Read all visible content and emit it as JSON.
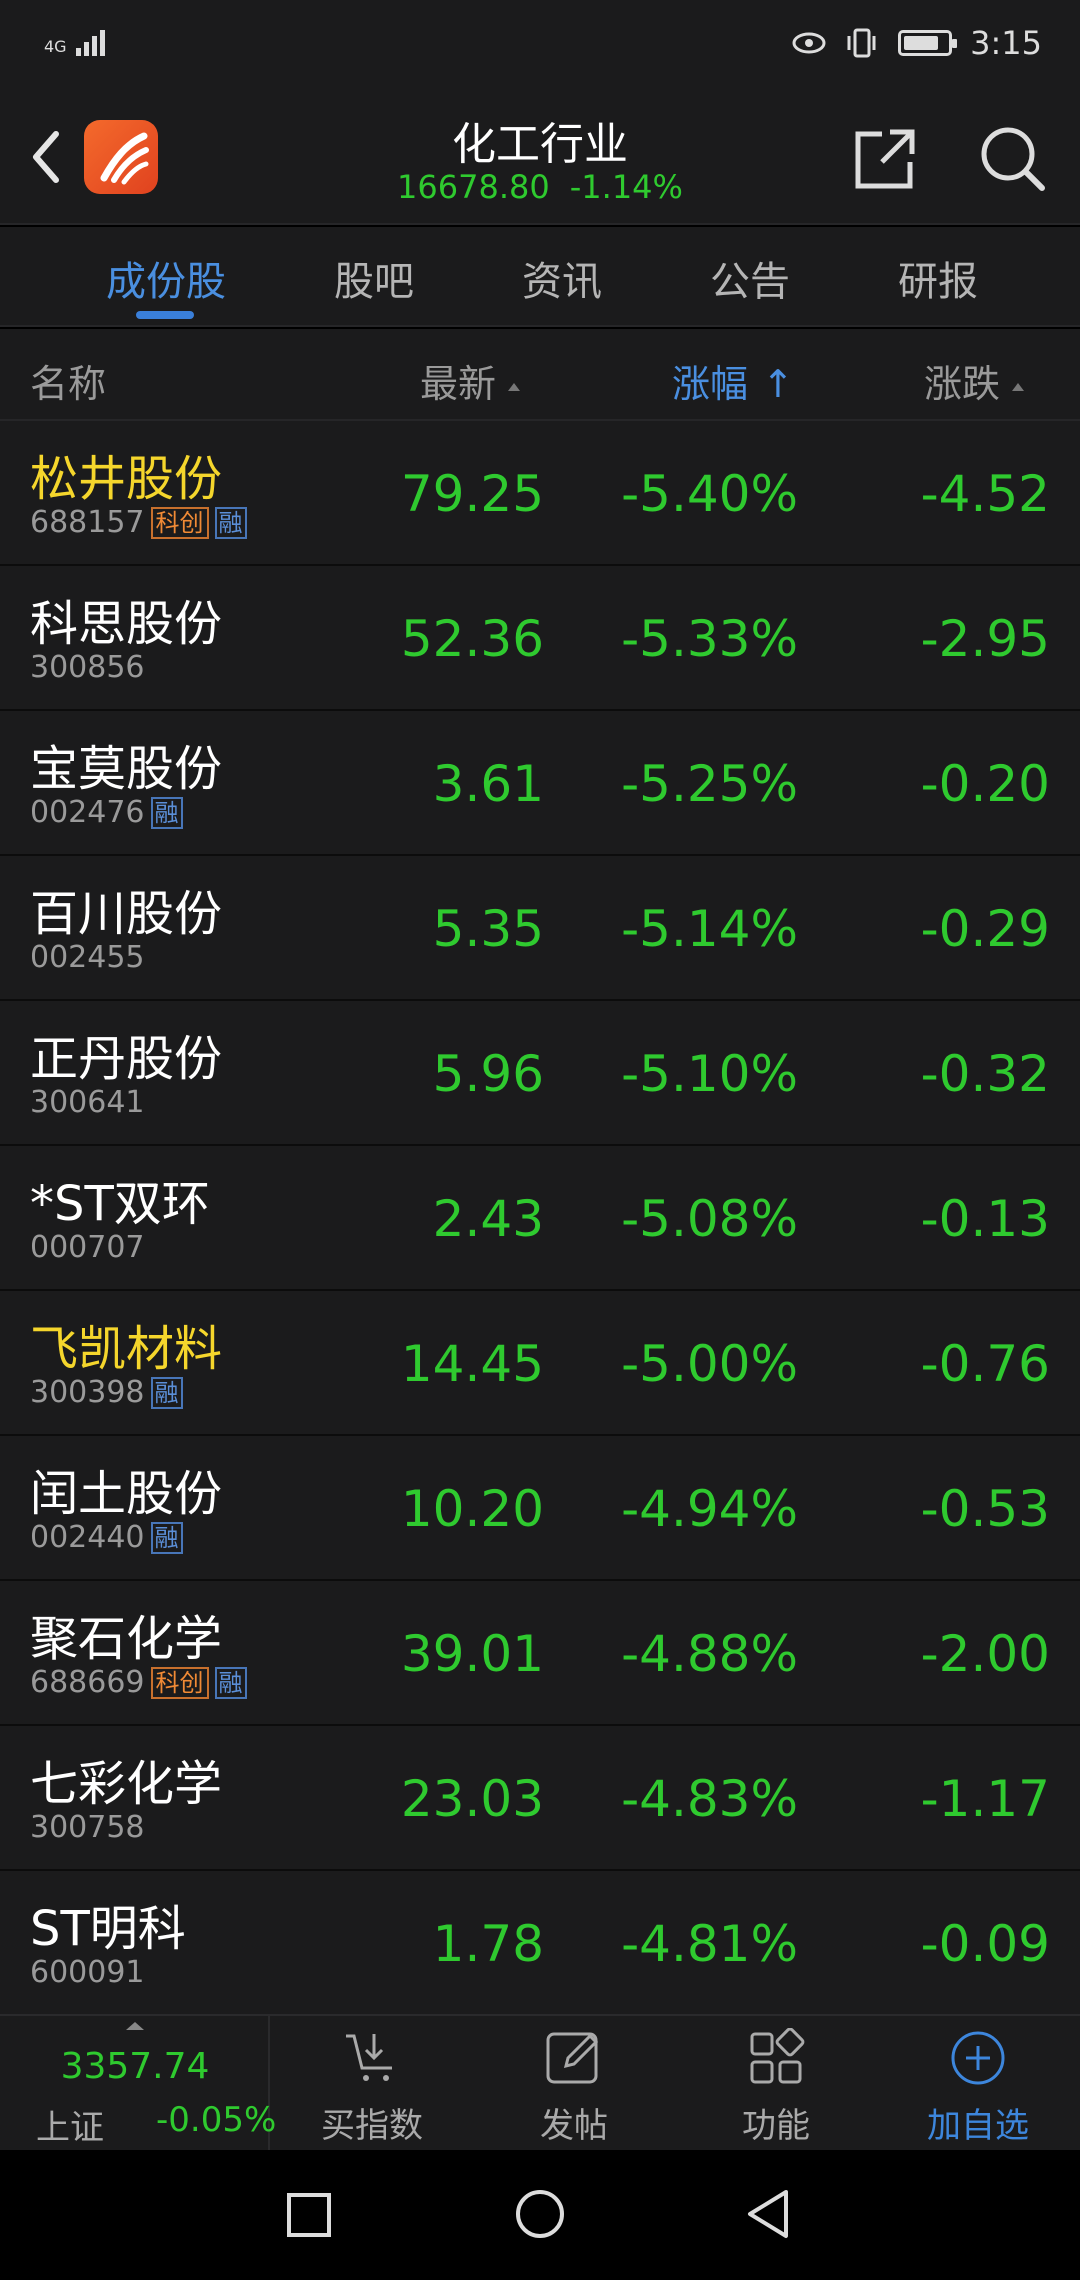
{
  "status_bar": {
    "network": "4G",
    "time": "3:15",
    "battery_level": 0.8
  },
  "header": {
    "title": "化工行业",
    "index_value": "16678.80",
    "index_change": "-1.14%"
  },
  "tabs": [
    {
      "label": "成份股",
      "active": true
    },
    {
      "label": "股吧",
      "active": false
    },
    {
      "label": "资讯",
      "active": false
    },
    {
      "label": "公告",
      "active": false
    },
    {
      "label": "研报",
      "active": false
    }
  ],
  "columns": {
    "name": "名称",
    "latest": "最新",
    "pct": "涨幅",
    "change": "涨跌"
  },
  "stocks": [
    {
      "name": "松井股份",
      "code": "688157",
      "kechuang": "科创",
      "rong": "融",
      "price": "79.25",
      "pct": "-5.40%",
      "change": "-4.52",
      "highlight": true
    },
    {
      "name": "科思股份",
      "code": "300856",
      "kechuang": "",
      "rong": "",
      "price": "52.36",
      "pct": "-5.33%",
      "change": "-2.95",
      "highlight": false
    },
    {
      "name": "宝莫股份",
      "code": "002476",
      "kechuang": "",
      "rong": "融",
      "price": "3.61",
      "pct": "-5.25%",
      "change": "-0.20",
      "highlight": false
    },
    {
      "name": "百川股份",
      "code": "002455",
      "kechuang": "",
      "rong": "",
      "price": "5.35",
      "pct": "-5.14%",
      "change": "-0.29",
      "highlight": false
    },
    {
      "name": "正丹股份",
      "code": "300641",
      "kechuang": "",
      "rong": "",
      "price": "5.96",
      "pct": "-5.10%",
      "change": "-0.32",
      "highlight": false
    },
    {
      "name": "*ST双环",
      "code": "000707",
      "kechuang": "",
      "rong": "",
      "price": "2.43",
      "pct": "-5.08%",
      "change": "-0.13",
      "highlight": false
    },
    {
      "name": "飞凯材料",
      "code": "300398",
      "kechuang": "",
      "rong": "融",
      "price": "14.45",
      "pct": "-5.00%",
      "change": "-0.76",
      "highlight": true
    },
    {
      "name": "闰土股份",
      "code": "002440",
      "kechuang": "",
      "rong": "融",
      "price": "10.20",
      "pct": "-4.94%",
      "change": "-0.53",
      "highlight": false
    },
    {
      "name": "聚石化学",
      "code": "688669",
      "kechuang": "科创",
      "rong": "融",
      "price": "39.01",
      "pct": "-4.88%",
      "change": "-2.00",
      "highlight": false
    },
    {
      "name": "七彩化学",
      "code": "300758",
      "kechuang": "",
      "rong": "",
      "price": "23.03",
      "pct": "-4.83%",
      "change": "-1.17",
      "highlight": false
    },
    {
      "name": "ST明科",
      "code": "600091",
      "kechuang": "",
      "rong": "",
      "price": "1.78",
      "pct": "-4.81%",
      "change": "-0.09",
      "highlight": false
    }
  ],
  "toolbar": {
    "index_value": "3357.74",
    "index_name": "上证",
    "index_pct": "-0.05%",
    "buy_index": "买指数",
    "post": "发帖",
    "functions": "功能",
    "add_watch": "加自选"
  },
  "colors": {
    "down_green": "#2fca2f",
    "accent_blue": "#4a8fe0",
    "highlight_yellow": "#f5d62c"
  }
}
